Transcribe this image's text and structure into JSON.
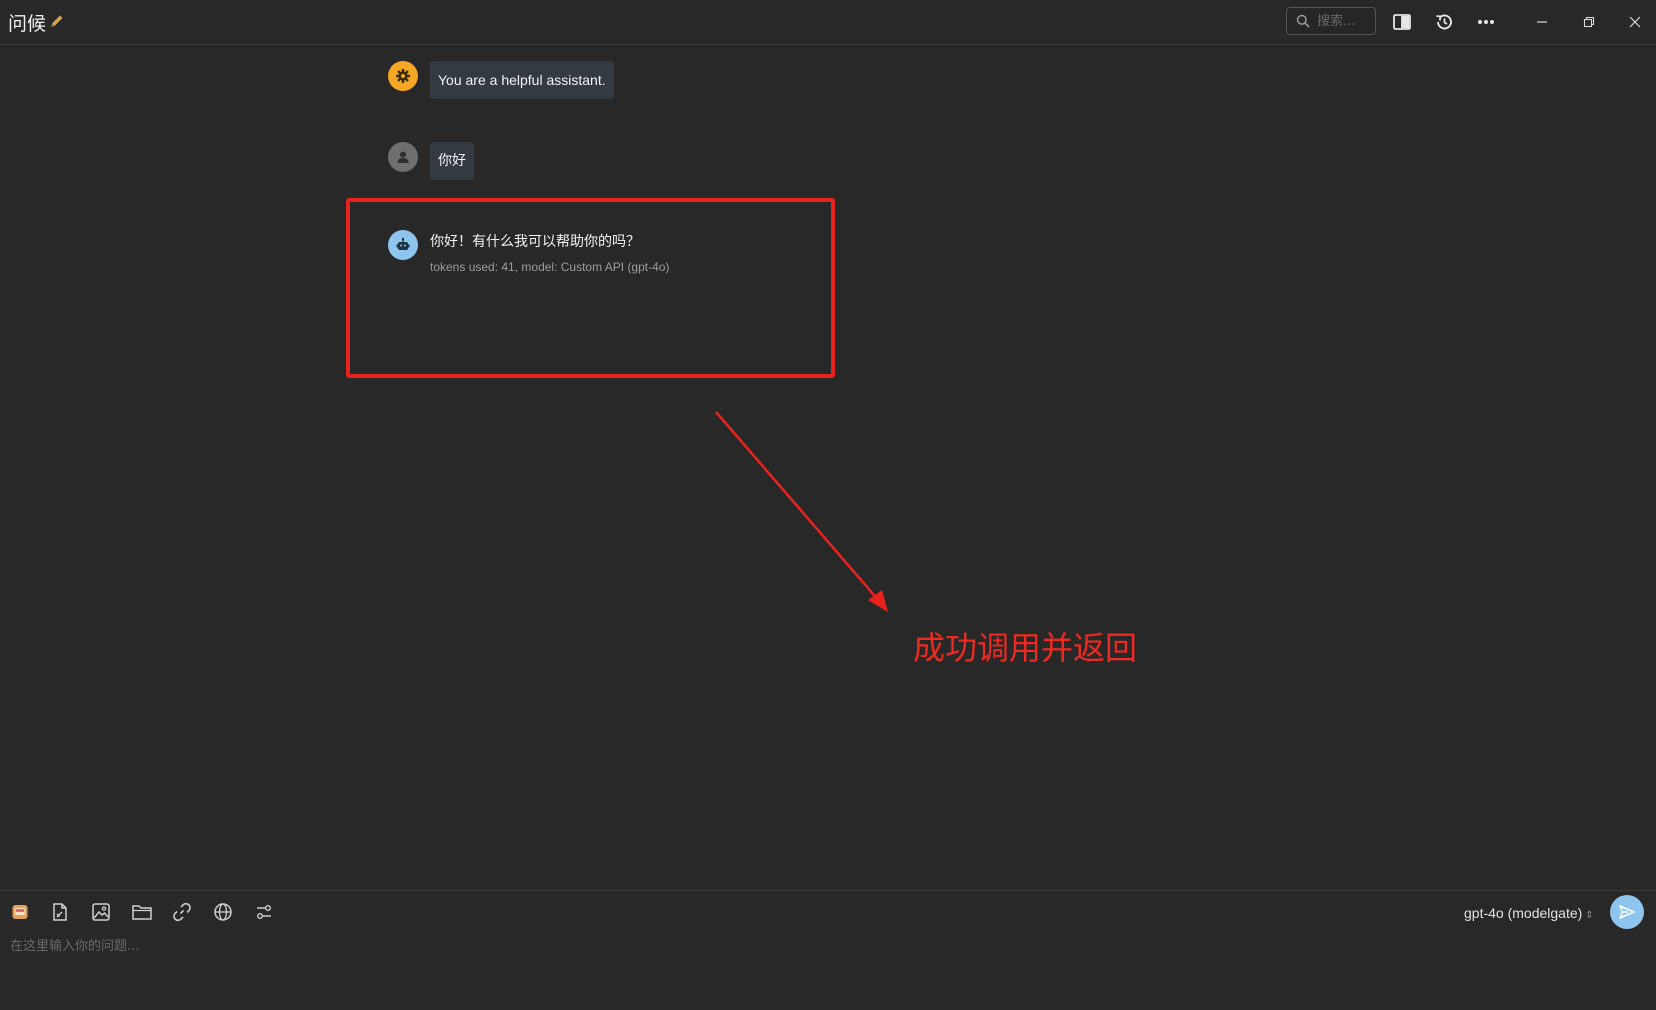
{
  "window": {
    "title": "问候",
    "edit_icon": "pencil-icon",
    "search_placeholder": "搜索...",
    "icons": [
      "toggle-panel-icon",
      "history-icon",
      "more-icon",
      "minimize-icon",
      "restore-icon",
      "close-icon"
    ]
  },
  "messages": {
    "system": {
      "text": "You are a helpful assistant.",
      "icon": "gear-icon"
    },
    "user": {
      "text": "你好",
      "icon": "user-icon"
    },
    "assistant": {
      "text": "你好！有什么我可以帮助你的吗？",
      "meta": "tokens used: 41, model: Custom API (gpt-4o)",
      "icon": "bot-icon"
    }
  },
  "annotation": {
    "text": "成功调用并返回",
    "color": "#ee2a20"
  },
  "composer": {
    "placeholder": "在这里输入你的问题...",
    "model": "gpt-4o (modelgate)",
    "tools": [
      "app-icon",
      "file-icon",
      "image-icon",
      "folder-icon",
      "link-icon",
      "globe-icon",
      "settings-sliders-icon"
    ],
    "send_icon": "send-icon"
  },
  "colors": {
    "background": "#282828",
    "bubble": "#343a42",
    "system_avatar": "#f5a623",
    "user_avatar": "#6f6f6f",
    "bot_avatar": "#8ec5ee",
    "send_button": "#8ec5ee"
  }
}
